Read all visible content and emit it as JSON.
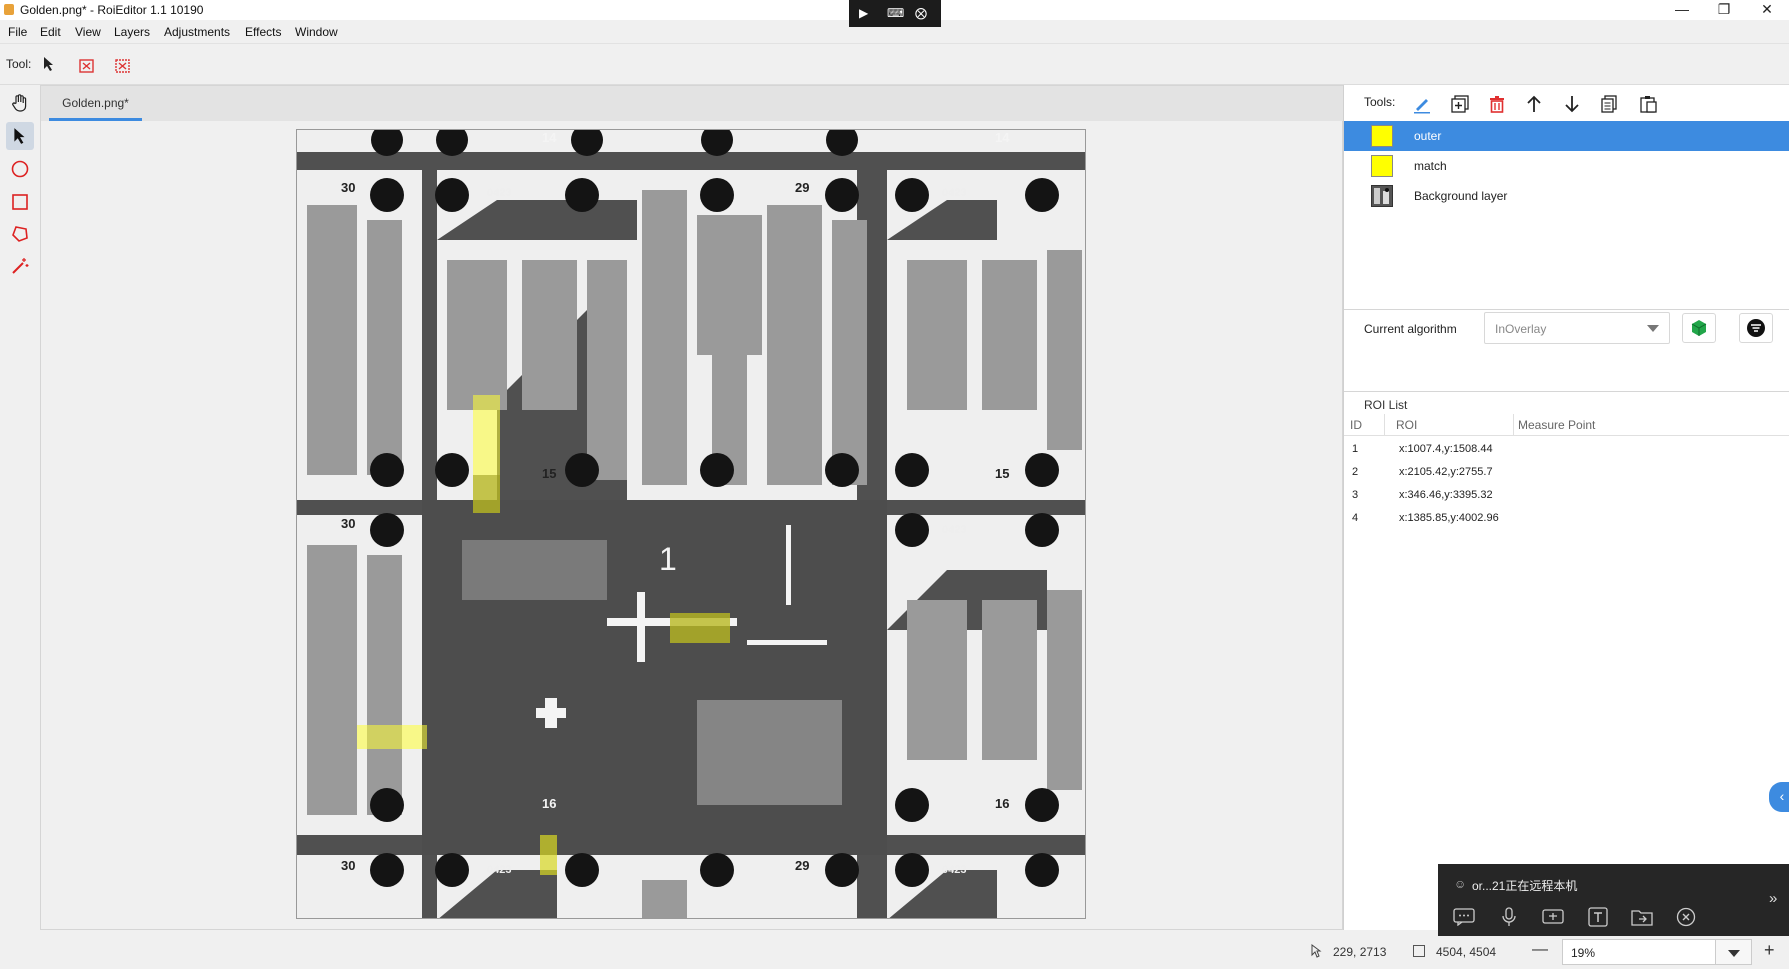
{
  "window": {
    "title": "Golden.png* - RoiEditor 1.1 10190",
    "remote_bar_icons": [
      "terminal-icon",
      "keyboard-icon",
      "close-circle-icon"
    ]
  },
  "menu": [
    "File",
    "Edit",
    "View",
    "Layers",
    "Adjustments",
    "Effects",
    "Window"
  ],
  "toolbar": {
    "tool_label": "Tool:"
  },
  "left_tools": [
    "hand-icon",
    "arrow-select-icon",
    "circle-icon",
    "rectangle-icon",
    "polygon-icon",
    "magic-wand-icon"
  ],
  "document": {
    "tab": "Golden.png*"
  },
  "image": {
    "labels": [
      "14",
      "14",
      "30",
      "29",
      "15",
      "15",
      "30",
      "16",
      "30",
      "29",
      "16",
      "1",
      "0423"
    ]
  },
  "panel": {
    "tools_label": "Tools:",
    "tool_icons": [
      "pencil-icon",
      "add-layer-icon",
      "delete-icon",
      "move-up-icon",
      "move-down-icon",
      "copy-icon",
      "paste-icon"
    ],
    "layers": [
      {
        "name": "outer",
        "swatch": "#ffff00",
        "selected": true
      },
      {
        "name": "match",
        "swatch": "#ffff00",
        "selected": false
      },
      {
        "name": "Background layer",
        "swatch": "image",
        "selected": false
      }
    ],
    "current_algorithm_label": "Current algorithm",
    "current_algorithm_value": "InOverlay",
    "roi_list_title": "ROI List",
    "roi_columns": [
      "ID",
      "ROI",
      "Measure Point"
    ],
    "roi_rows": [
      {
        "id": "1",
        "roi": "x:1007.4,y:1508.44",
        "measure": ""
      },
      {
        "id": "2",
        "roi": "x:2105.42,y:2755.7",
        "measure": ""
      },
      {
        "id": "3",
        "roi": "x:346.46,y:3395.32",
        "measure": ""
      },
      {
        "id": "4",
        "roi": "x:1385.85,y:4002.96",
        "measure": ""
      }
    ]
  },
  "remote_popup": {
    "text": "or...21正在远程本机"
  },
  "status": {
    "cursor_pos": "229, 2713",
    "image_size": "4504, 4504",
    "zoom": "19%"
  },
  "colors": {
    "accent": "#3d8be0",
    "roi_yellow": "#ffff00",
    "delete_red": "#e03030",
    "run_green": "#22a64a"
  }
}
